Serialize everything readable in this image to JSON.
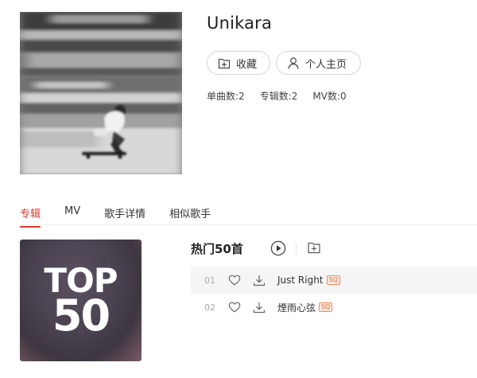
{
  "artist": {
    "name": "Unikara",
    "favorite_label": "收藏",
    "profile_label": "个人主页",
    "stats": {
      "songs": "单曲数:2",
      "albums": "专辑数:2",
      "mvs": "MV数:0"
    }
  },
  "tabs": [
    {
      "label": "专辑",
      "active": true
    },
    {
      "label": "MV",
      "active": false
    },
    {
      "label": "歌手详情",
      "active": false
    },
    {
      "label": "相似歌手",
      "active": false
    }
  ],
  "album": {
    "title": "热门50首",
    "cover_text_top": "TOP",
    "cover_text_number": "50",
    "tracks": [
      {
        "no": "01",
        "title": "Just Right",
        "badge": "SQ"
      },
      {
        "no": "02",
        "title": "煙雨心弦",
        "badge": "SQ"
      }
    ]
  },
  "colors": {
    "accent": "#d33a31",
    "sq_badge": "#e36b3a",
    "row_highlight": "#f5f5f5"
  },
  "icons": {
    "favorite": "add-to-folder-icon",
    "profile": "user-icon",
    "play": "play-circle-icon",
    "add": "add-to-folder-icon",
    "like": "heart-icon",
    "download": "download-icon"
  }
}
